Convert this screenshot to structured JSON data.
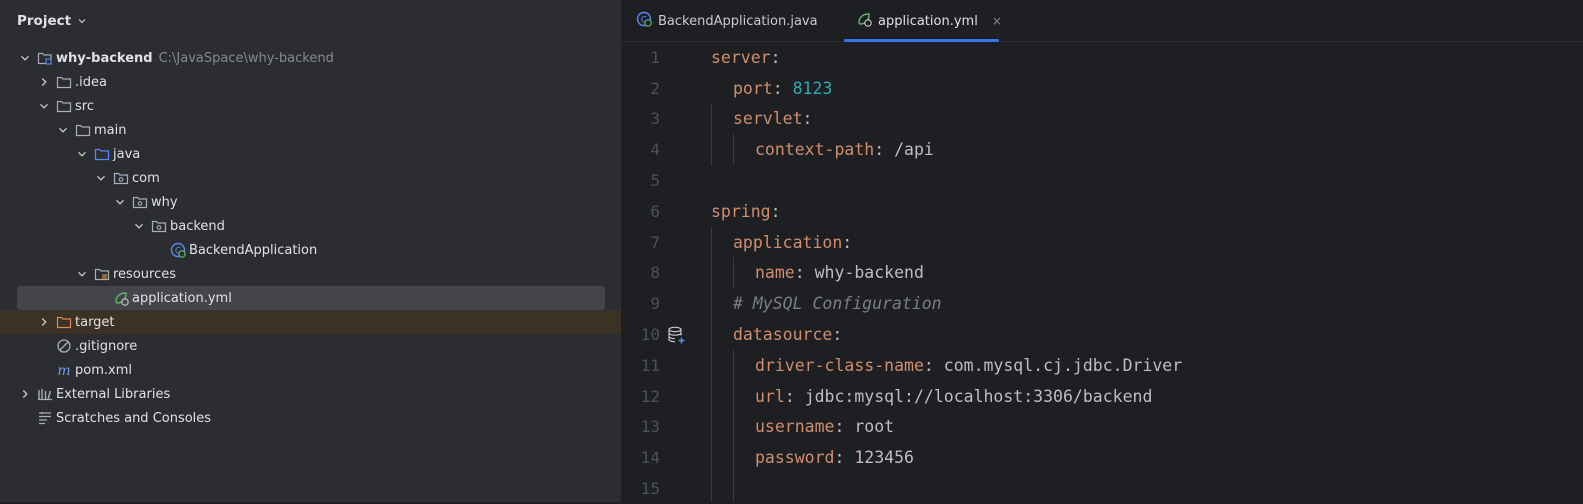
{
  "project_panel": {
    "title": "Project",
    "tree": [
      {
        "label": "why-backend",
        "path": "C:\\JavaSpace\\why-backend",
        "icon": "module-folder-icon",
        "arrow": "expanded",
        "depth": 0
      },
      {
        "label": ".idea",
        "icon": "folder-icon",
        "arrow": "collapsed",
        "depth": 1
      },
      {
        "label": "src",
        "icon": "folder-icon",
        "arrow": "expanded",
        "depth": 1
      },
      {
        "label": "main",
        "icon": "folder-icon",
        "arrow": "expanded",
        "depth": 2
      },
      {
        "label": "java",
        "icon": "source-folder-icon",
        "arrow": "expanded",
        "depth": 3
      },
      {
        "label": "com",
        "icon": "package-icon",
        "arrow": "expanded",
        "depth": 4
      },
      {
        "label": "why",
        "icon": "package-icon",
        "arrow": "expanded",
        "depth": 5
      },
      {
        "label": "backend",
        "icon": "package-icon",
        "arrow": "expanded",
        "depth": 6
      },
      {
        "label": "BackendApplication",
        "icon": "spring-boot-class-icon",
        "arrow": "none",
        "depth": 7
      },
      {
        "label": "resources",
        "icon": "resources-folder-icon",
        "arrow": "expanded",
        "depth": 3
      },
      {
        "label": "application.yml",
        "icon": "spring-yml-icon",
        "arrow": "none",
        "depth": 4,
        "selected": true
      },
      {
        "label": "target",
        "icon": "excluded-folder-icon",
        "arrow": "collapsed",
        "depth": 1,
        "excluded": true
      },
      {
        "label": ".gitignore",
        "icon": "gitignore-icon",
        "arrow": "none",
        "depth": 1
      },
      {
        "label": "pom.xml",
        "icon": "maven-icon",
        "arrow": "none",
        "depth": 1
      },
      {
        "label": "External Libraries",
        "icon": "libraries-icon",
        "arrow": "collapsed",
        "depth": 0
      },
      {
        "label": "Scratches and Consoles",
        "icon": "scratches-icon",
        "arrow": "none",
        "depth": 0
      }
    ]
  },
  "editor": {
    "tabs": [
      {
        "label": "BackendApplication.java",
        "icon": "spring-boot-class-icon",
        "active": false
      },
      {
        "label": "application.yml",
        "icon": "spring-yml-icon",
        "active": true,
        "close": "×"
      }
    ],
    "lines": [
      {
        "n": "1",
        "indent": 0,
        "key": "server",
        "sep": ":",
        "val": "",
        "type": ""
      },
      {
        "n": "2",
        "indent": 1,
        "key": "port",
        "sep": ": ",
        "val": "8123",
        "type": "num"
      },
      {
        "n": "3",
        "indent": 1,
        "key": "servlet",
        "sep": ":",
        "val": "",
        "type": ""
      },
      {
        "n": "4",
        "indent": 2,
        "key": "context-path",
        "sep": ": ",
        "val": "/api",
        "type": "str"
      },
      {
        "n": "5",
        "indent": 0,
        "key": "",
        "sep": "",
        "val": "",
        "type": ""
      },
      {
        "n": "6",
        "indent": 0,
        "key": "spring",
        "sep": ":",
        "val": "",
        "type": ""
      },
      {
        "n": "7",
        "indent": 1,
        "key": "application",
        "sep": ":",
        "val": "",
        "type": ""
      },
      {
        "n": "8",
        "indent": 2,
        "key": "name",
        "sep": ": ",
        "val": "why-backend",
        "type": "str"
      },
      {
        "n": "9",
        "indent": 1,
        "comment": "# MySQL Configuration"
      },
      {
        "n": "10",
        "indent": 1,
        "key": "datasource",
        "sep": ":",
        "val": "",
        "type": "",
        "gutter": "database-add-icon"
      },
      {
        "n": "11",
        "indent": 2,
        "key": "driver-class-name",
        "sep": ": ",
        "val": "com.mysql.cj.jdbc.Driver",
        "type": "str"
      },
      {
        "n": "12",
        "indent": 2,
        "key": "url",
        "sep": ": ",
        "val": "jdbc:mysql://localhost:3306/backend",
        "type": "str"
      },
      {
        "n": "13",
        "indent": 2,
        "key": "username",
        "sep": ": ",
        "val": "root",
        "type": "str"
      },
      {
        "n": "14",
        "indent": 2,
        "key": "password",
        "sep": ": ",
        "val": "123456",
        "type": "str"
      },
      {
        "n": "15",
        "indent": 0,
        "key": "",
        "sep": "",
        "val": "",
        "type": ""
      }
    ]
  },
  "colors": {
    "accent": "#3574f0",
    "key": "#cf8e6d",
    "number": "#2aacb8",
    "comment": "#7a7e85",
    "selection": "#43454a",
    "excluded_bg": "#3b3125"
  }
}
